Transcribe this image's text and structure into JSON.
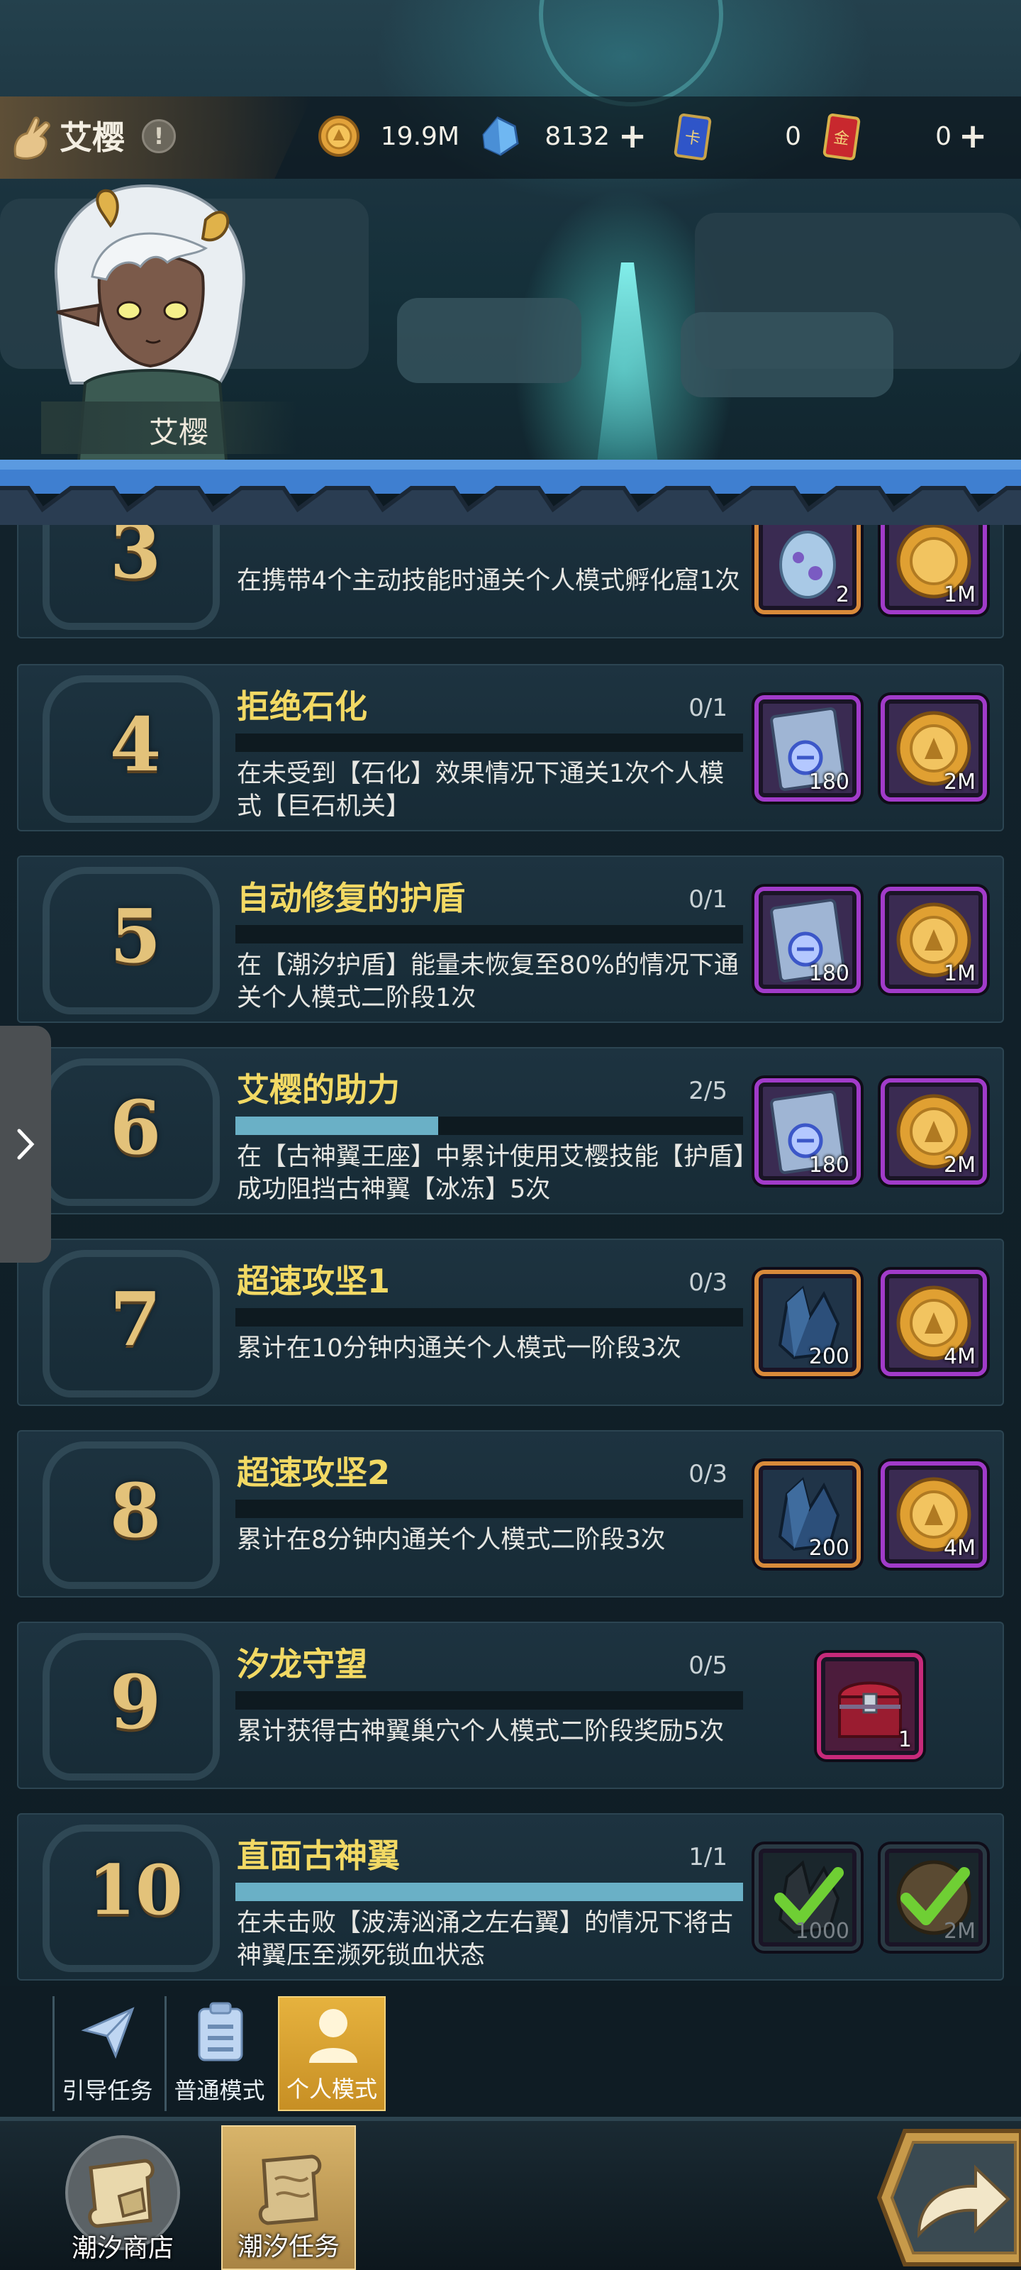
{
  "header": {
    "character_name": "艾樱",
    "resources": [
      {
        "id": "gold",
        "icon": "gold-coin-icon",
        "value": "19.9M",
        "has_plus": false
      },
      {
        "id": "crystal",
        "icon": "blue-crystal-icon",
        "value": "8132",
        "has_plus": true
      },
      {
        "id": "blue-ticket",
        "icon": "blue-card-icon",
        "value": "0",
        "has_plus": false
      },
      {
        "id": "red-ticket",
        "icon": "red-card-icon",
        "value": "0",
        "has_plus": true
      }
    ]
  },
  "character": {
    "label": "艾樱"
  },
  "tasks": [
    {
      "num": "3",
      "title": "",
      "progress": "",
      "progress_fraction": null,
      "desc": "在携带4个主动技能时通关个人模式孵化窟1次",
      "rewards": [
        {
          "icon": "egg-icon",
          "qty": "2",
          "frame": "orange"
        },
        {
          "icon": "gold-coin-icon",
          "qty": "1M",
          "frame": "purple"
        }
      ]
    },
    {
      "num": "4",
      "title": "拒绝石化",
      "progress": "0/1",
      "progress_fraction": 0,
      "desc": "在未受到【石化】效果情况下通关1次个人模式【巨石机关】",
      "rewards": [
        {
          "icon": "scroll-icon",
          "qty": "180",
          "frame": "purple"
        },
        {
          "icon": "gold-coin-icon",
          "qty": "2M",
          "frame": "purple"
        }
      ]
    },
    {
      "num": "5",
      "title": "自动修复的护盾",
      "progress": "0/1",
      "progress_fraction": 0,
      "desc": "在【潮汐护盾】能量未恢复至80%的情况下通关个人模式二阶段1次",
      "rewards": [
        {
          "icon": "scroll-icon",
          "qty": "180",
          "frame": "purple"
        },
        {
          "icon": "gold-coin-icon",
          "qty": "1M",
          "frame": "purple"
        }
      ]
    },
    {
      "num": "6",
      "title": "艾樱的助力",
      "progress": "2/5",
      "progress_fraction": 0.4,
      "desc": "在【古神翼王座】中累计使用艾樱技能【护盾】成功阻挡古神翼【冰冻】5次",
      "rewards": [
        {
          "icon": "scroll-icon",
          "qty": "180",
          "frame": "purple"
        },
        {
          "icon": "gold-coin-icon",
          "qty": "2M",
          "frame": "purple"
        }
      ]
    },
    {
      "num": "7",
      "title": "超速攻坚1",
      "progress": "0/3",
      "progress_fraction": 0,
      "desc": "累计在10分钟内通关个人模式一阶段3次",
      "rewards": [
        {
          "icon": "dark-crystal-icon",
          "qty": "200",
          "frame": "orange"
        },
        {
          "icon": "gold-coin-icon",
          "qty": "4M",
          "frame": "purple"
        }
      ]
    },
    {
      "num": "8",
      "title": "超速攻坚2",
      "progress": "0/3",
      "progress_fraction": 0,
      "desc": "累计在8分钟内通关个人模式二阶段3次",
      "rewards": [
        {
          "icon": "dark-crystal-icon",
          "qty": "200",
          "frame": "orange"
        },
        {
          "icon": "gold-coin-icon",
          "qty": "4M",
          "frame": "purple"
        }
      ]
    },
    {
      "num": "9",
      "title": "汐龙守望",
      "progress": "0/5",
      "progress_fraction": 0,
      "desc": "累计获得古神翼巢穴个人模式二阶段奖励5次",
      "rewards": [
        {
          "icon": "treasure-chest-icon",
          "qty": "1",
          "frame": "magenta"
        }
      ]
    },
    {
      "num": "10",
      "title": "直面古神翼",
      "progress": "1/1",
      "progress_fraction": 1,
      "desc": "在未击败【波涛汹涌之左右翼】的情况下将古神翼压至濒死锁血状态",
      "rewards": [
        {
          "icon": "dark-crystal-icon",
          "qty": "1000",
          "frame": "done",
          "claimed": true
        },
        {
          "icon": "gold-coin-icon",
          "qty": "2M",
          "frame": "done",
          "claimed": true
        }
      ]
    }
  ],
  "mode_tabs": [
    {
      "label": "引导任务",
      "icon": "paper-plane-icon",
      "active": false
    },
    {
      "label": "普通模式",
      "icon": "clipboard-icon",
      "active": false
    },
    {
      "label": "个人模式",
      "icon": "person-icon",
      "active": true
    }
  ],
  "bottom_nav": [
    {
      "label": "潮汐商店",
      "icon": "scroll-shop-icon",
      "active": false
    },
    {
      "label": "潮汐任务",
      "icon": "scroll-quest-icon",
      "active": true
    }
  ],
  "colors": {
    "title_yellow": "#f2d964",
    "number_gold": "#e3c27a",
    "progress_fill": "#6ab0c6",
    "active_tab": "#e6b23e"
  }
}
